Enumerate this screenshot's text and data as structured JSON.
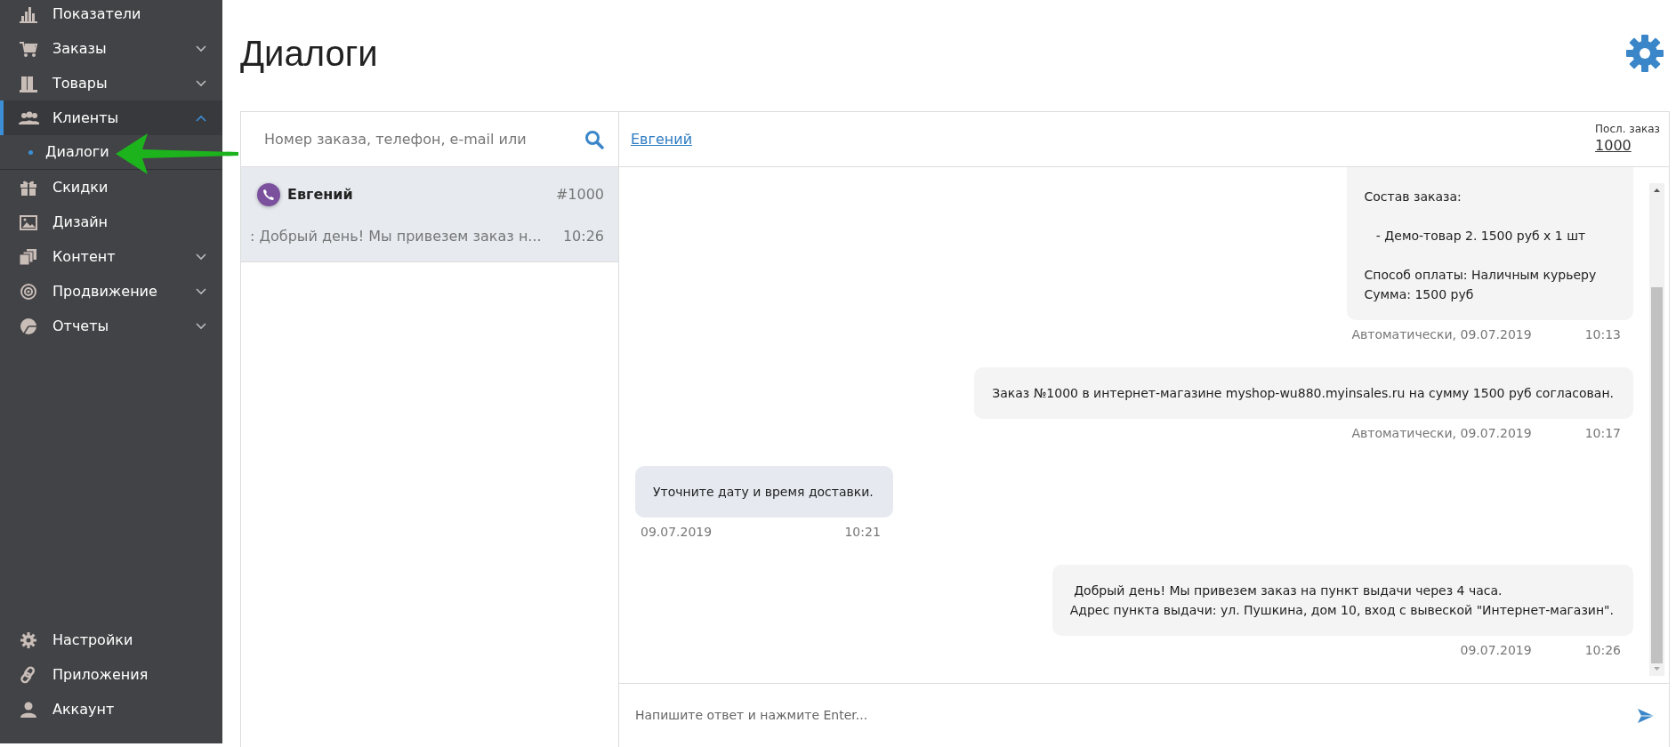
{
  "sidebar": {
    "items": [
      {
        "label": "Показатели",
        "kind": "link",
        "selected": false
      },
      {
        "label": "Заказы",
        "kind": "group",
        "expanded": false,
        "selected": false
      },
      {
        "label": "Товары",
        "kind": "group",
        "expanded": false,
        "selected": false
      },
      {
        "label": "Клиенты",
        "kind": "group",
        "expanded": true,
        "selected": true,
        "children": [
          {
            "label": "Диалоги",
            "selected": true
          }
        ]
      },
      {
        "label": "Скидки",
        "kind": "link",
        "selected": false
      },
      {
        "label": "Дизайн",
        "kind": "link",
        "selected": false
      },
      {
        "label": "Контент",
        "kind": "group",
        "expanded": false,
        "selected": false
      },
      {
        "label": "Продвижение",
        "kind": "group",
        "expanded": false,
        "selected": false
      },
      {
        "label": "Отчеты",
        "kind": "group",
        "expanded": false,
        "selected": false
      }
    ],
    "bottom_items": [
      {
        "label": "Настройки"
      },
      {
        "label": "Приложения"
      },
      {
        "label": "Аккаунт"
      }
    ]
  },
  "pointer_arrow": true,
  "page": {
    "title": "Диалоги"
  },
  "search": {
    "placeholder": "Номер заказа, телефон, e-mail или"
  },
  "conversations": [
    {
      "name": "Евгений",
      "order": "#1000",
      "preview": ": Добрый день! Мы привезем заказ н...",
      "time": "10:26",
      "selected": true
    }
  ],
  "chat": {
    "contact": "Евгений",
    "last_order_label": "Посл. заказ",
    "last_order": "1000",
    "messages": [
      {
        "kind": "outgoing",
        "text": "Состав заказа:\n\n   - Демо-товар 2. 1500 руб x 1 шт\n\nСпособ оплаты: Наличным курьеру\nСумма: 1500 руб",
        "meta": "Автоматически, 09.07.2019",
        "time": "10:13",
        "clipped": true
      },
      {
        "kind": "outgoing",
        "text": "Заказ №1000 в интернет-магазине myshop-wu880.myinsales.ru на сумму 1500 руб согласован.",
        "meta": "Автоматически, 09.07.2019",
        "time": "10:17"
      },
      {
        "kind": "incoming",
        "text": "Уточните дату и время доставки.",
        "meta": "09.07.2019",
        "time": "10:21"
      },
      {
        "kind": "outgoing",
        "text": " Добрый день! Мы привезем заказ на пункт выдачи через 4 часа.\nАдрес пункта выдачи: ул. Пушкина, дом 10, вход с вывеской \"Интернет-магазин\".",
        "meta": "09.07.2019",
        "time": "10:26"
      }
    ],
    "reply_placeholder": "Напишите ответ и нажмите Enter..."
  }
}
